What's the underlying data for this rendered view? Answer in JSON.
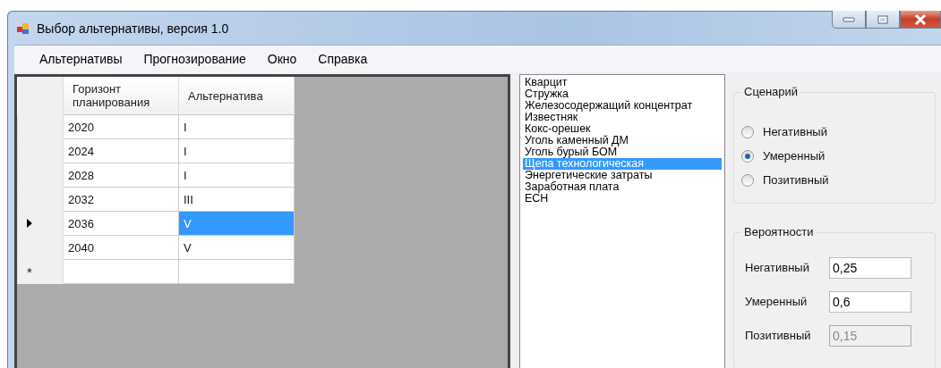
{
  "window": {
    "title": "Выбор альтернативы, версия 1.0"
  },
  "menu": [
    "Альтернативы",
    "Прогнозирование",
    "Окно",
    "Справка"
  ],
  "grid": {
    "columns": [
      "Горизонт планирования",
      "Альтернатива"
    ],
    "rows": [
      {
        "kind": "data",
        "current": false,
        "cells": [
          {
            "text": "2020",
            "selected": false
          },
          {
            "text": "I",
            "selected": false
          }
        ]
      },
      {
        "kind": "data",
        "current": false,
        "cells": [
          {
            "text": "2024",
            "selected": false
          },
          {
            "text": "I",
            "selected": false
          }
        ]
      },
      {
        "kind": "data",
        "current": false,
        "cells": [
          {
            "text": "2028",
            "selected": false
          },
          {
            "text": "I",
            "selected": false
          }
        ]
      },
      {
        "kind": "data",
        "current": false,
        "cells": [
          {
            "text": "2032",
            "selected": false
          },
          {
            "text": "III",
            "selected": false
          }
        ]
      },
      {
        "kind": "data",
        "current": true,
        "cells": [
          {
            "text": "2036",
            "selected": false
          },
          {
            "text": "V",
            "selected": true
          }
        ]
      },
      {
        "kind": "data",
        "current": false,
        "cells": [
          {
            "text": "2040",
            "selected": false
          },
          {
            "text": "V",
            "selected": false
          }
        ]
      },
      {
        "kind": "new",
        "marker": "*"
      }
    ]
  },
  "list": {
    "items": [
      {
        "label": "Кварцит",
        "selected": false
      },
      {
        "label": "Стружка",
        "selected": false
      },
      {
        "label": "Железосодержащий концентрат",
        "selected": false
      },
      {
        "label": "Известняк",
        "selected": false
      },
      {
        "label": "Кокс-орешек",
        "selected": false
      },
      {
        "label": "Уголь каменный ДМ",
        "selected": false
      },
      {
        "label": "Уголь бурый БОМ",
        "selected": false
      },
      {
        "label": "Щепа технологическая",
        "selected": true
      },
      {
        "label": "Энергетические затраты",
        "selected": false
      },
      {
        "label": "Заработная плата",
        "selected": false
      },
      {
        "label": "ЕСН",
        "selected": false
      }
    ]
  },
  "scenario": {
    "title": "Сценарий",
    "options": [
      {
        "label": "Негативный",
        "selected": false
      },
      {
        "label": "Умеренный",
        "selected": true
      },
      {
        "label": "Позитивный",
        "selected": false
      }
    ]
  },
  "probabilities": {
    "title": "Вероятности",
    "fields": [
      {
        "label": "Негативный",
        "value": "0,25",
        "disabled": false
      },
      {
        "label": "Умеренный",
        "value": "0,6",
        "disabled": false
      },
      {
        "label": "Позитивный",
        "value": "0,15",
        "disabled": true
      }
    ]
  }
}
